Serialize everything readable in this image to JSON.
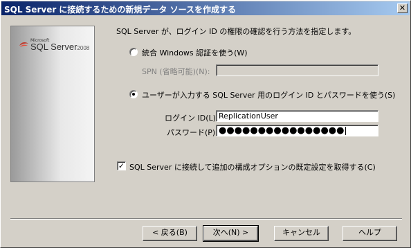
{
  "window": {
    "title": "SQL Server に接続するための新規データ ソースを作成する",
    "close_glyph": "✕"
  },
  "logo": {
    "brand": "Microsoft",
    "product": "SQL Server",
    "year": "2008"
  },
  "content": {
    "instruction": "SQL Server が、ログイン ID の権限の確認を行う方法を指定します。",
    "option_windows": "統合 Windows 認証を使う(W)",
    "spn_label": "SPN (省略可能)(N):",
    "spn_value": "",
    "option_sql": "ユーザーが入力する SQL Server 用のログイン ID とパスワードを使う(S)",
    "login_label": "ログイン ID(L):",
    "login_value": "ReplicationUser",
    "password_label": "パスワード(P):",
    "password_masked": "●●●●●●●●●●●●●●●●",
    "connect_checkbox_label": "SQL Server に接続して追加の構成オプションの既定設定を取得する(C)",
    "connect_checked_glyph": "✓"
  },
  "buttons": {
    "back": "< 戻る(B)",
    "next": "次へ(N) >",
    "cancel": "キャンセル",
    "help": "ヘルプ"
  }
}
